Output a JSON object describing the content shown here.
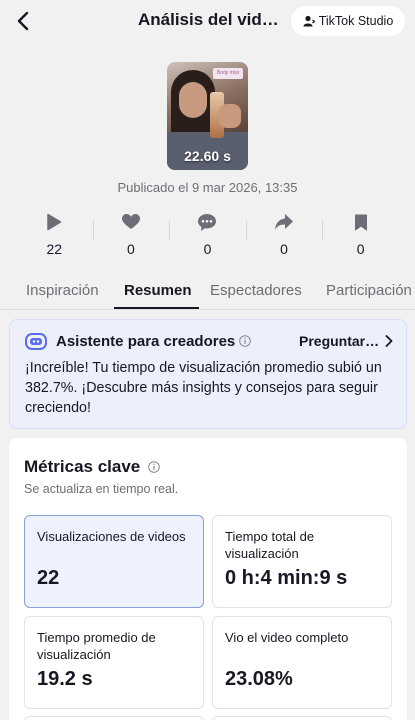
{
  "header": {
    "title": "Análisis del vid…",
    "studio_button": "TikTok Studio"
  },
  "video": {
    "duration": "22.60 s",
    "sticker_text": "Body mist",
    "published": "Publicado el 9 mar 2026, 13:35"
  },
  "stats": [
    {
      "icon": "play-icon",
      "value": "22"
    },
    {
      "icon": "heart-icon",
      "value": "0"
    },
    {
      "icon": "comment-icon",
      "value": "0"
    },
    {
      "icon": "share-icon",
      "value": "0"
    },
    {
      "icon": "bookmark-icon",
      "value": "0"
    }
  ],
  "tabs": [
    {
      "label": "Inspiración",
      "active": false
    },
    {
      "label": "Resumen",
      "active": true
    },
    {
      "label": "Espectadores",
      "active": false
    },
    {
      "label": "Participación",
      "active": false
    }
  ],
  "assistant": {
    "title": "Asistente para creadores",
    "ask_link": "Preguntar…",
    "message": "¡Increíble! Tu tiempo de visualización promedio subió un 382.7%. ¡Descubre más insights y consejos para seguir creciendo!"
  },
  "metrics": {
    "title": "Métricas clave",
    "subtitle": "Se actualiza en tiempo real.",
    "items": [
      {
        "label": "Visualizaciones de videos",
        "value": "22",
        "selected": true
      },
      {
        "label": "Tiempo total de visualización",
        "value": "0 h:4 min:9 s",
        "selected": false
      },
      {
        "label": "Tiempo promedio de visualización",
        "value": "19.2 s",
        "selected": false
      },
      {
        "label": "Vio el video completo",
        "value": "23.08%",
        "selected": false
      }
    ]
  },
  "colors": {
    "accent": "#161823",
    "muted": "#6d6e75",
    "assistant_bg": "#edf0fb",
    "selected_border": "#8aa0d8"
  }
}
